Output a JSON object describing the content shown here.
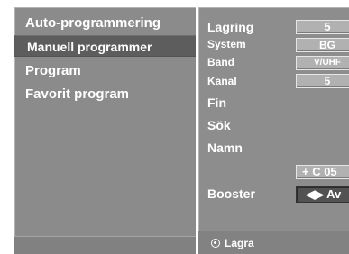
{
  "menu": {
    "items": [
      {
        "label": "Auto-programmering"
      },
      {
        "label": "Manuell programmer",
        "selected": true
      },
      {
        "label": "Program"
      },
      {
        "label": "Favorit program"
      }
    ]
  },
  "settings": {
    "storage": {
      "label": "Lagring",
      "value": "5"
    },
    "system": {
      "label": "System",
      "value": "BG"
    },
    "band": {
      "label": "Band",
      "value": "V/UHF"
    },
    "channel": {
      "label": "Kanal",
      "value": "5"
    },
    "fine": {
      "label": "Fin"
    },
    "search": {
      "label": "Sök",
      "value": "+ C 05"
    },
    "name": {
      "label": "Namn"
    },
    "booster": {
      "label": "Booster",
      "value": "◀▶ Av"
    }
  },
  "footer": {
    "save_label": "Lagra",
    "save_icon": "ok-button-icon"
  },
  "colors": {
    "panel": "#8b8b8b",
    "selected_row": "#5d5d5d",
    "value_box": "#b1b1b1",
    "value_box_dark": "#525252",
    "text": "#ffffff"
  }
}
